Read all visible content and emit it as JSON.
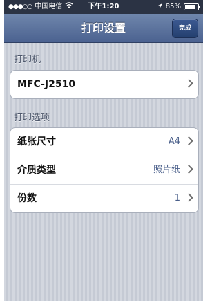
{
  "status_bar": {
    "carrier": "中国电信",
    "time": "下午1:20",
    "battery_text": "85%",
    "battery_level": 0.85
  },
  "nav": {
    "title": "打印设置",
    "done_label": "完成"
  },
  "printer_section": {
    "header": "打印机",
    "printer_name": "MFC-J2510"
  },
  "options_section": {
    "header": "打印选项",
    "rows": [
      {
        "label": "纸张尺寸",
        "value": "A4"
      },
      {
        "label": "介质类型",
        "value": "照片纸"
      },
      {
        "label": "份数",
        "value": "1"
      }
    ]
  }
}
